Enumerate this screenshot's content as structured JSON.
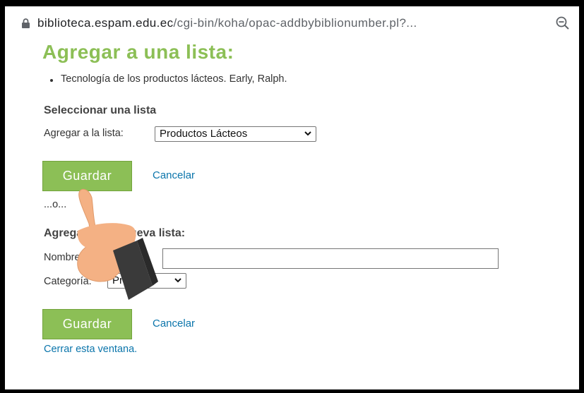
{
  "browser": {
    "url_domain": "biblioteca.espam.edu.ec",
    "url_path": "/cgi-bin/koha/opac-addbybiblionumber.pl?...",
    "icons": {
      "lock": "lock-icon",
      "zoom": "zoom-out-icon"
    }
  },
  "page": {
    "title": "Agregar a una lista:",
    "item": "Tecnología de los productos lácteos. Early, Ralph.",
    "select_section": {
      "heading": "Seleccionar una lista",
      "label": "Agregar a la lista:",
      "selected": "Productos Lácteos"
    },
    "save_label": "Guardar",
    "cancel_label": "Cancelar",
    "or_text": "...o...",
    "new_section": {
      "heading": "Agregar a una nueva lista:",
      "name_label": "Nombre de la lista:",
      "name_value": "",
      "category_label": "Categoría:",
      "category_selected": "Privada"
    },
    "close_label": "Cerrar esta ventana."
  },
  "colors": {
    "accent_green": "#8cbf56",
    "link_blue": "#0b75ab",
    "hand_skin": "#f4b184",
    "hand_sleeve": "#3a3a3a"
  }
}
